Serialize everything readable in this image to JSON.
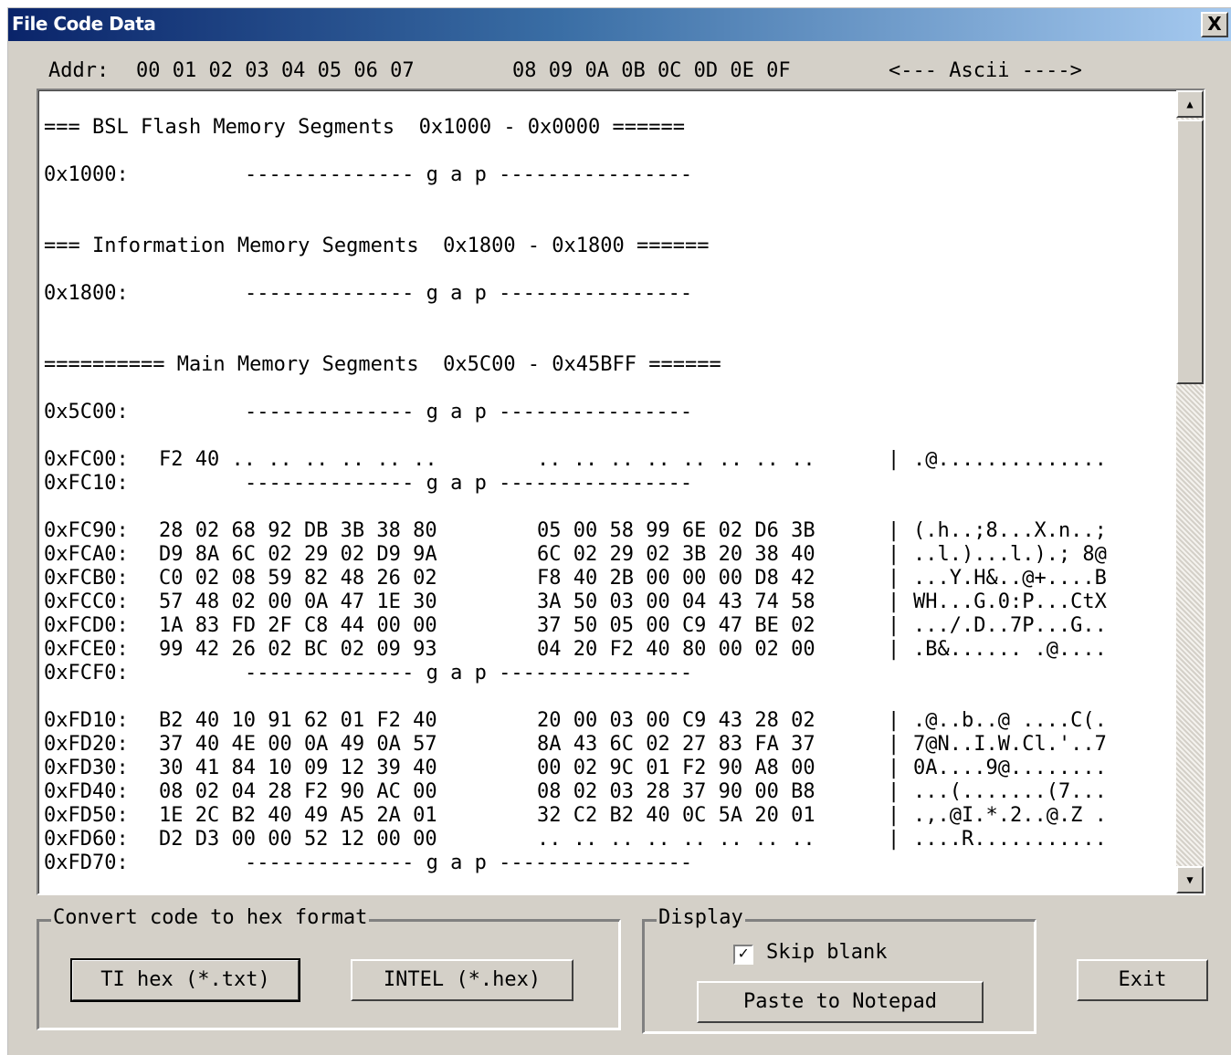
{
  "window": {
    "title": "File Code Data",
    "close_glyph": "X"
  },
  "header": {
    "addr": "Addr:",
    "bytes_a": "00 01 02 03 04 05 06 07",
    "bytes_b": "08 09 0A 0B 0C 0D 0E 0F",
    "ascii": "<--- Ascii ---->"
  },
  "hexview": {
    "gap_text": "-------------- g a p ----------------",
    "bsl_section": "=== BSL Flash Memory Segments  0x1000 - 0x0000 ======",
    "info_section": "=== Information Memory Segments  0x1800 - 0x1800 ======",
    "main_section": "========== Main Memory Segments  0x5C00 - 0x45BFF ======",
    "rows": [
      {
        "addr": "0x1000:"
      },
      {
        "addr": "0x1800:"
      },
      {
        "addr": "0x5C00:"
      },
      {
        "addr": "0xFC00:",
        "a": "F2 40 .. .. .. .. .. ..",
        "b": ".. .. .. .. .. .. .. ..",
        "sep": "|",
        "ascii": ".@.............."
      },
      {
        "addr": "0xFC10:"
      },
      {
        "addr": "0xFC90:",
        "a": "28 02 68 92 DB 3B 38 80",
        "b": "05 00 58 99 6E 02 D6 3B",
        "sep": "|",
        "ascii": "(.h..;8...X.n..;"
      },
      {
        "addr": "0xFCA0:",
        "a": "D9 8A 6C 02 29 02 D9 9A",
        "b": "6C 02 29 02 3B 20 38 40",
        "sep": "|",
        "ascii": "..l.)...l.).; 8@"
      },
      {
        "addr": "0xFCB0:",
        "a": "C0 02 08 59 82 48 26 02",
        "b": "F8 40 2B 00 00 00 D8 42",
        "sep": "|",
        "ascii": "...Y.H&..@+....B"
      },
      {
        "addr": "0xFCC0:",
        "a": "57 48 02 00 0A 47 1E 30",
        "b": "3A 50 03 00 04 43 74 58",
        "sep": "|",
        "ascii": "WH...G.0:P...CtX"
      },
      {
        "addr": "0xFCD0:",
        "a": "1A 83 FD 2F C8 44 00 00",
        "b": "37 50 05 00 C9 47 BE 02",
        "sep": "|",
        "ascii": ".../.D..7P...G.."
      },
      {
        "addr": "0xFCE0:",
        "a": "99 42 26 02 BC 02 09 93",
        "b": "04 20 F2 40 80 00 02 00",
        "sep": "|",
        "ascii": ".B&...... .@...."
      },
      {
        "addr": "0xFCF0:"
      },
      {
        "addr": "0xFD10:",
        "a": "B2 40 10 91 62 01 F2 40",
        "b": "20 00 03 00 C9 43 28 02",
        "sep": "|",
        "ascii": ".@..b..@ ....C(."
      },
      {
        "addr": "0xFD20:",
        "a": "37 40 4E 00 0A 49 0A 57",
        "b": "8A 43 6C 02 27 83 FA 37",
        "sep": "|",
        "ascii": "7@N..I.W.Cl.'..7"
      },
      {
        "addr": "0xFD30:",
        "a": "30 41 84 10 09 12 39 40",
        "b": "00 02 9C 01 F2 90 A8 00",
        "sep": "|",
        "ascii": "0A....9@........"
      },
      {
        "addr": "0xFD40:",
        "a": "08 02 04 28 F2 90 AC 00",
        "b": "08 02 03 28 37 90 00 B8",
        "sep": "|",
        "ascii": "...(.......(7..."
      },
      {
        "addr": "0xFD50:",
        "a": "1E 2C B2 40 49 A5 2A 01",
        "b": "32 C2 B2 40 0C 5A 20 01",
        "sep": "|",
        "ascii": ".,.@I.*.2..@.Z ."
      },
      {
        "addr": "0xFD60:",
        "a": "D2 D3 00 00 52 12 00 00",
        "b": ".. .. .. .. .. .. .. ..",
        "sep": "|",
        "ascii": "....R..........."
      },
      {
        "addr": "0xFD70:"
      }
    ]
  },
  "scrollbar": {
    "up_glyph": "▲",
    "down_glyph": "▼"
  },
  "convert_group": {
    "label": "Convert code to hex format",
    "ti_hex_button": "TI hex (*.txt)",
    "intel_button": "INTEL (*.hex)"
  },
  "display_group": {
    "label": "Display",
    "skip_blank_label": "Skip blank",
    "skip_blank_checked": true,
    "check_glyph": "✓",
    "paste_button": "Paste to Notepad"
  },
  "exit_button": "Exit"
}
